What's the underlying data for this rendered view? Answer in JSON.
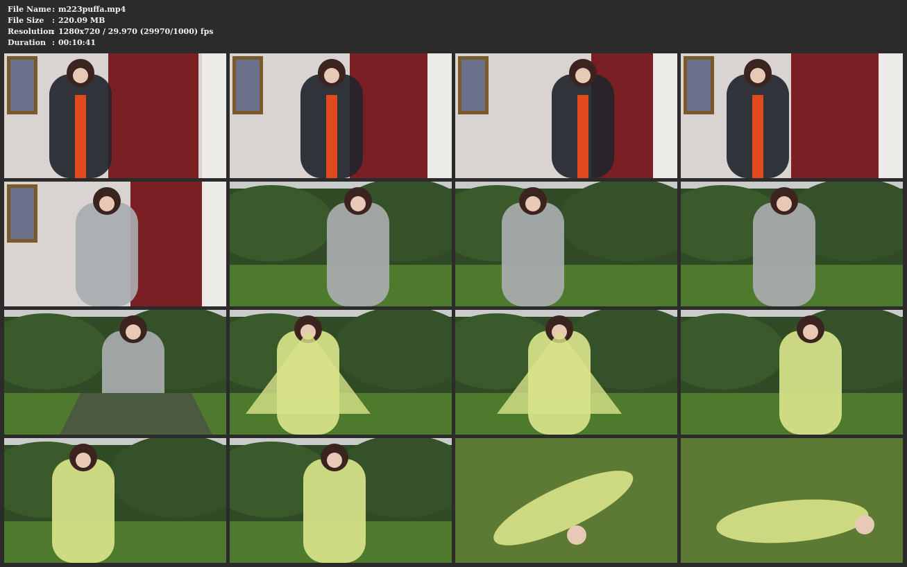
{
  "info": {
    "rows": [
      {
        "label": "File Name",
        "value": "m223puffa.mp4"
      },
      {
        "label": "File Size",
        "value": "220.09 MB"
      },
      {
        "label": "Resolution",
        "value": "1280x720 / 29.970 (29970/1000) fps"
      },
      {
        "label": "Duration",
        "value": "00:10:41"
      }
    ],
    "separator": ":"
  },
  "thumbnails": [
    {
      "scene": "indoor",
      "subject": "black-puffer-jacket"
    },
    {
      "scene": "indoor",
      "subject": "black-puffer-closeup"
    },
    {
      "scene": "indoor",
      "subject": "black-puffer-back"
    },
    {
      "scene": "indoor",
      "subject": "black-puffer-with-clear-coat"
    },
    {
      "scene": "indoor",
      "subject": "grey-coat-over-puffer"
    },
    {
      "scene": "garden",
      "subject": "grey-coat-closeup"
    },
    {
      "scene": "garden",
      "subject": "grey-coat-full"
    },
    {
      "scene": "garden",
      "subject": "grey-coat-arms-out"
    },
    {
      "scene": "garden",
      "subject": "grey-coat-umbrella"
    },
    {
      "scene": "garden",
      "subject": "yellow-cape-spread"
    },
    {
      "scene": "garden",
      "subject": "yellow-cape-twirl"
    },
    {
      "scene": "garden",
      "subject": "yellow-coat-closeup"
    },
    {
      "scene": "garden",
      "subject": "yellow-coat-standing"
    },
    {
      "scene": "garden",
      "subject": "yellow-coat-arms-out"
    },
    {
      "scene": "lawn",
      "subject": "yellow-coat-lying"
    },
    {
      "scene": "lawn",
      "subject": "yellow-coat-curled"
    }
  ],
  "colors": {
    "background": "#2b2b2b",
    "text": "#f2f2f2",
    "wall": "#d9d4d2",
    "red_wall": "#7a1f24",
    "grass": "#4d7a2c",
    "bush": "#2f4a24",
    "puffer": "#22252b",
    "orange": "#e04a1c",
    "grey_coat": "#a9adaf",
    "yellow_coat": "#d8e38a"
  }
}
